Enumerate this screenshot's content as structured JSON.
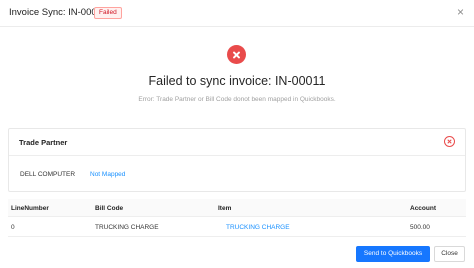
{
  "header": {
    "title": "Invoice Sync: IN-00011",
    "status_badge": "Failed",
    "close_glyph": "×",
    "badge_color": "#cf1322"
  },
  "result": {
    "icon": "error-circle-icon",
    "title": "Failed to sync invoice: IN-00011",
    "subtitle": "Error: Trade Partner or Bill Code donot been mapped in Quickbooks.",
    "icon_color": "#e94b4b"
  },
  "trade_partner": {
    "title": "Trade Partner",
    "icon": "close-circle-icon",
    "name": "DELL COMPUTER",
    "status": "Not Mapped"
  },
  "table": {
    "columns": [
      "LineNumber",
      "Bill Code",
      "Item",
      "Account"
    ],
    "rows": [
      [
        "0",
        "TRUCKING CHARGE",
        "TRUCKING CHARGE",
        "500.00"
      ]
    ]
  },
  "footer": {
    "primary_label": "Send to Quickbooks",
    "close_label": "Close",
    "primary_color": "#1677ff"
  }
}
